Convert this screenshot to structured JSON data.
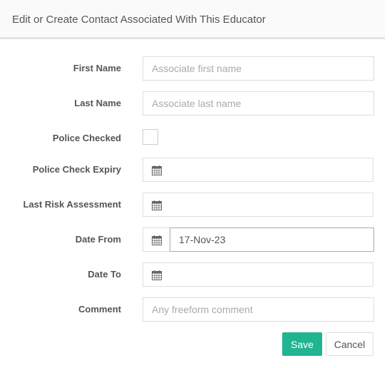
{
  "modal": {
    "title": "Edit or Create Contact Associated With This Educator"
  },
  "form": {
    "first_name": {
      "label": "First Name",
      "placeholder": "Associate first name",
      "value": ""
    },
    "last_name": {
      "label": "Last Name",
      "placeholder": "Associate last name",
      "value": ""
    },
    "police_checked": {
      "label": "Police Checked",
      "checked": false
    },
    "police_check_expiry": {
      "label": "Police Check Expiry",
      "value": ""
    },
    "last_risk_assessment": {
      "label": "Last Risk Assessment",
      "value": ""
    },
    "date_from": {
      "label": "Date From",
      "value": "17-Nov-23"
    },
    "date_to": {
      "label": "Date To",
      "value": ""
    },
    "comment": {
      "label": "Comment",
      "placeholder": "Any freeform comment",
      "value": ""
    }
  },
  "buttons": {
    "save_label": "Save",
    "cancel_label": "Cancel"
  },
  "icons": {
    "date_addon": "calendar-icon"
  },
  "colors": {
    "save_button": "#1fb591",
    "header_bg": "#fafafa",
    "label_text": "#555555"
  }
}
